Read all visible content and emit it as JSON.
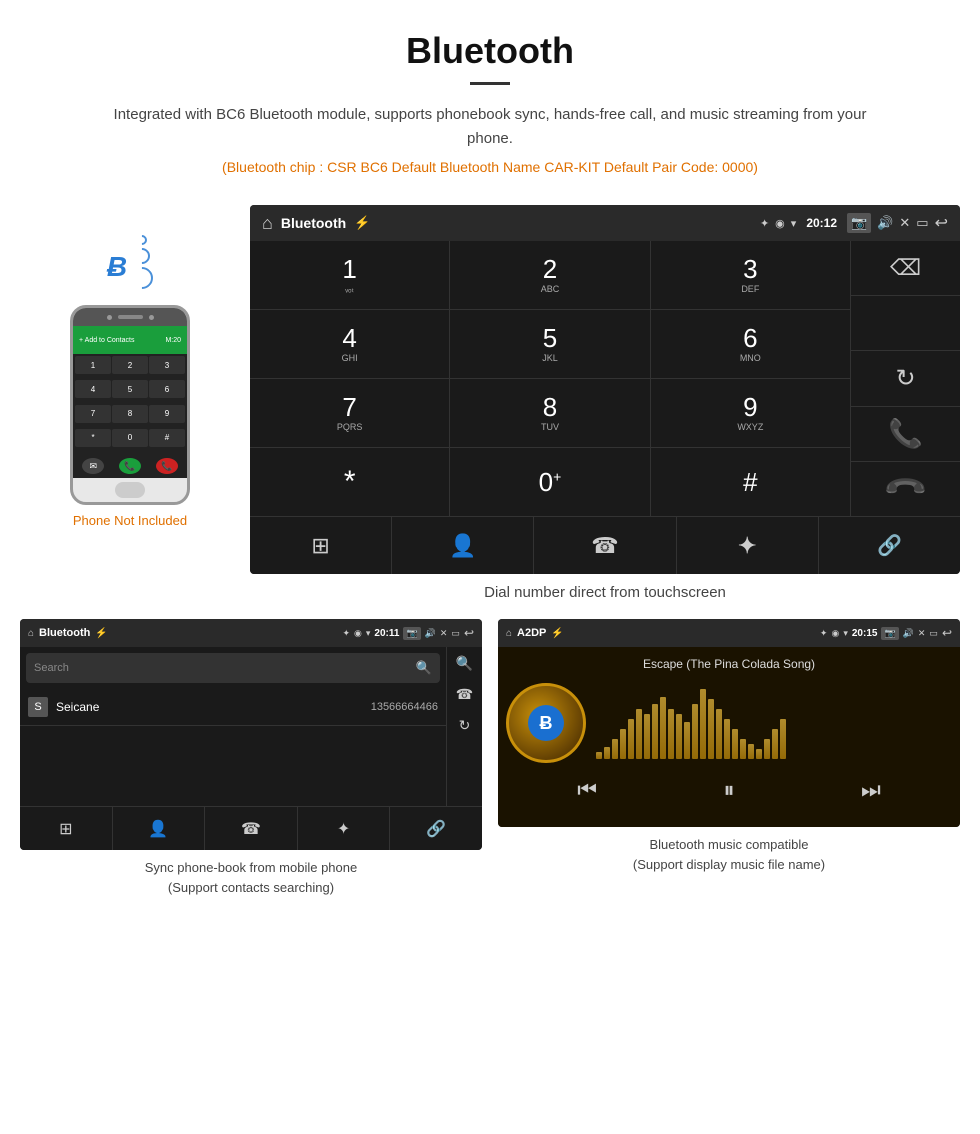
{
  "header": {
    "title": "Bluetooth",
    "description": "Integrated with BC6 Bluetooth module, supports phonebook sync, hands-free call, and music streaming from your phone.",
    "specs": "(Bluetooth chip : CSR BC6    Default Bluetooth Name CAR-KIT    Default Pair Code: 0000)"
  },
  "phone_label": "Phone Not Included",
  "dialpad_screen": {
    "status_bar": {
      "title": "Bluetooth",
      "time": "20:12"
    },
    "keys": [
      {
        "num": "1",
        "alpha": ""
      },
      {
        "num": "2",
        "alpha": "ABC"
      },
      {
        "num": "3",
        "alpha": "DEF"
      },
      {
        "num": "4",
        "alpha": "GHI"
      },
      {
        "num": "5",
        "alpha": "JKL"
      },
      {
        "num": "6",
        "alpha": "MNO"
      },
      {
        "num": "7",
        "alpha": "PQRS"
      },
      {
        "num": "8",
        "alpha": "TUV"
      },
      {
        "num": "9",
        "alpha": "WXYZ"
      },
      {
        "num": "*",
        "alpha": ""
      },
      {
        "num": "0",
        "alpha": "+"
      },
      {
        "num": "#",
        "alpha": ""
      }
    ],
    "caption": "Dial number direct from touchscreen"
  },
  "phonebook_screen": {
    "status_bar": {
      "title": "Bluetooth",
      "time": "20:11"
    },
    "search_placeholder": "Search",
    "contacts": [
      {
        "letter": "S",
        "name": "Seicane",
        "number": "13566664466"
      }
    ],
    "caption_line1": "Sync phone-book from mobile phone",
    "caption_line2": "(Support contacts searching)"
  },
  "music_screen": {
    "status_bar": {
      "title": "A2DP",
      "time": "20:15"
    },
    "song_title": "Escape (The Pina Colada Song)",
    "caption_line1": "Bluetooth music compatible",
    "caption_line2": "(Support display music file name)"
  },
  "nav_icons": {
    "grid": "⊞",
    "person": "👤",
    "phone": "📞",
    "bluetooth": "Ƀ",
    "link": "🔗"
  },
  "viz_bars": [
    3,
    5,
    8,
    12,
    16,
    20,
    18,
    22,
    25,
    20,
    18,
    15,
    22,
    28,
    24,
    20,
    16,
    12,
    8,
    6,
    4,
    8,
    12,
    16
  ]
}
